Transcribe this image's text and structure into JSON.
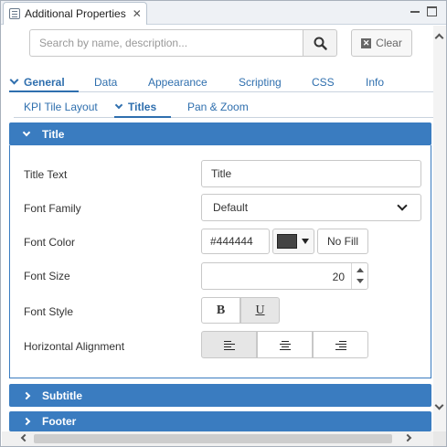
{
  "window": {
    "tab_title": "Additional Properties",
    "close_glyph": "✕"
  },
  "search": {
    "placeholder": "Search by name, description...",
    "value": "",
    "clear_label": "Clear",
    "clear_glyph": "✕"
  },
  "main_tabs": [
    {
      "label": "General",
      "active": true
    },
    {
      "label": "Data",
      "active": false
    },
    {
      "label": "Appearance",
      "active": false
    },
    {
      "label": "Scripting",
      "active": false
    },
    {
      "label": "CSS",
      "active": false
    },
    {
      "label": "Info",
      "active": false
    }
  ],
  "sub_tabs": [
    {
      "label": "KPI Tile Layout",
      "active": false
    },
    {
      "label": "Titles",
      "active": true
    },
    {
      "label": "Pan & Zoom",
      "active": false
    }
  ],
  "sections": {
    "title": {
      "label": "Title",
      "expanded": true
    },
    "subtitle": {
      "label": "Subtitle",
      "expanded": false
    },
    "footer": {
      "label": "Footer",
      "expanded": false
    }
  },
  "properties": {
    "title_text": {
      "label": "Title Text",
      "value": "Title"
    },
    "font_family": {
      "label": "Font Family",
      "value": "Default"
    },
    "font_color": {
      "label": "Font Color",
      "value": "#444444",
      "swatch": "#444444",
      "no_fill_label": "No Fill"
    },
    "font_size": {
      "label": "Font Size",
      "value": "20"
    },
    "font_style": {
      "label": "Font Style",
      "bold_label": "B",
      "underline_label": "U",
      "underline_selected": true,
      "bold_selected": false
    },
    "horizontal_alignment": {
      "label": "Horizontal Alignment",
      "selected": "left"
    }
  },
  "colors": {
    "accent": "#3a7cc0",
    "tab_text": "#2f6fae"
  }
}
